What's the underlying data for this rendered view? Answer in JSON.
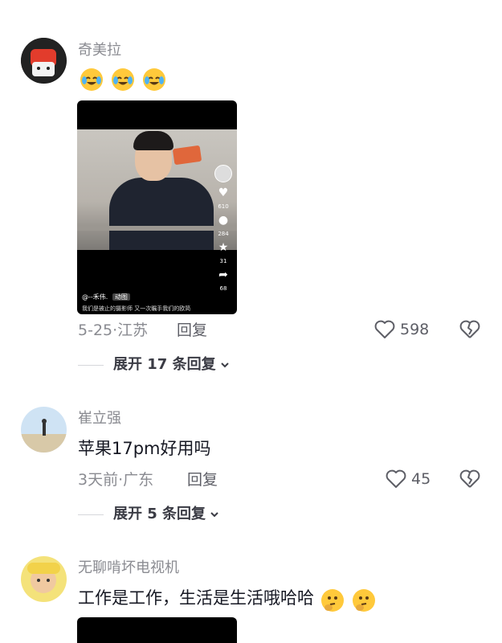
{
  "comments": [
    {
      "username": "奇美拉",
      "emojis": [
        "crying-laughing-emoji",
        "crying-laughing-emoji",
        "crying-laughing-emoji"
      ],
      "video": {
        "author": "@--禾伟.",
        "author_badge": "动图",
        "caption": "我们是被止的摄影师 又一次瞩手我们的欧简",
        "side_counts": {
          "like": "610",
          "comment": "284",
          "favorite": "31",
          "share": "68"
        }
      },
      "meta": "5-25·江苏",
      "reply_label": "回复",
      "like_count": "598",
      "expand_label": "展开 17 条回复"
    },
    {
      "username": "崔立强",
      "text": "苹果17pm好用吗",
      "meta": "3天前·广东",
      "reply_label": "回复",
      "like_count": "45",
      "expand_label": "展开 5 条回复"
    },
    {
      "username": "无聊啃坏电视机",
      "text": "工作是工作，生活是生活哦哈哈",
      "emojis": [
        "thinking-face-emoji",
        "thinking-face-emoji"
      ]
    }
  ],
  "colors": {
    "text_primary": "#161823",
    "text_secondary": "#8a8b91",
    "action": "#5d5e66",
    "emoji_yellow": "#ffc93b"
  }
}
